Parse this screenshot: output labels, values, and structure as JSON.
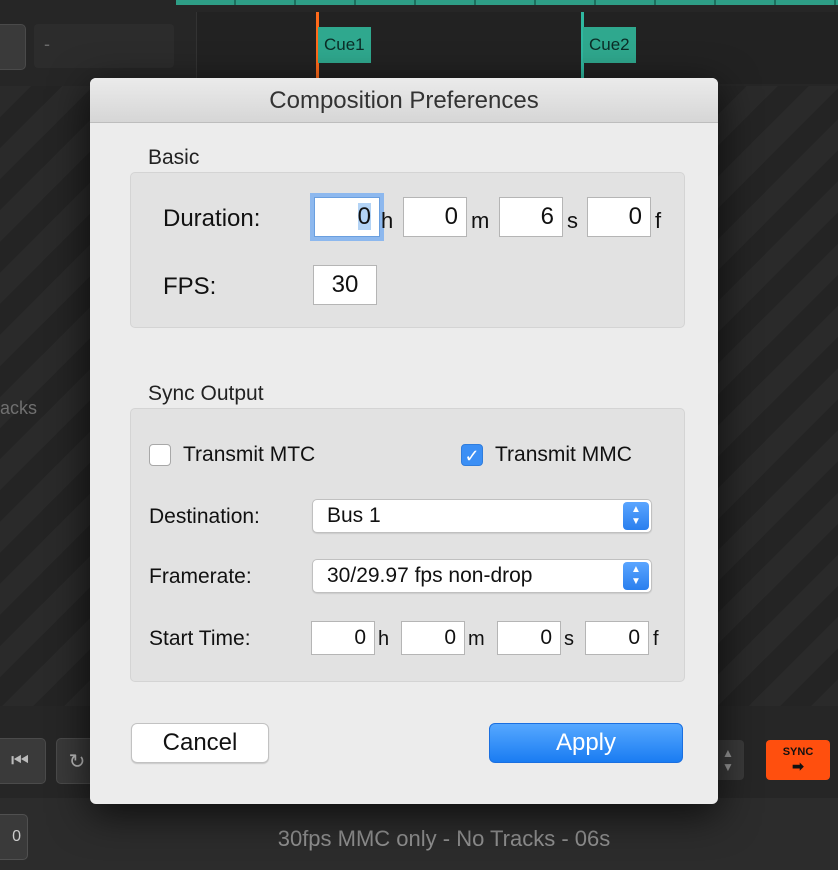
{
  "background": {
    "top_field_text": "-",
    "cues": [
      {
        "label": "Cue1",
        "color": "#ff6a1a"
      },
      {
        "label": "Cue2",
        "color": "#2fb8a0"
      }
    ],
    "side_text": "acks",
    "bottom_left_label": "0",
    "sync_label": "SYNC",
    "sync_arrow": "➡",
    "status_text": "30fps MMC only - No Tracks - 06s"
  },
  "dialog": {
    "title": "Composition Preferences",
    "basic": {
      "section_label": "Basic",
      "duration_label": "Duration:",
      "duration": {
        "h": "0",
        "m": "0",
        "s": "6",
        "f": "0"
      },
      "units": {
        "h": "h",
        "m": "m",
        "s": "s",
        "f": "f"
      },
      "fps_label": "FPS:",
      "fps_value": "30"
    },
    "sync_output": {
      "section_label": "Sync Output",
      "transmit_mtc_label": "Transmit MTC",
      "transmit_mtc_checked": false,
      "transmit_mmc_label": "Transmit MMC",
      "transmit_mmc_checked": true,
      "destination_label": "Destination:",
      "destination_value": "Bus 1",
      "framerate_label": "Framerate:",
      "framerate_value": "30/29.97 fps non-drop",
      "start_time_label": "Start Time:",
      "start_time": {
        "h": "0",
        "m": "0",
        "s": "0",
        "f": "0"
      }
    },
    "cancel_label": "Cancel",
    "apply_label": "Apply"
  }
}
